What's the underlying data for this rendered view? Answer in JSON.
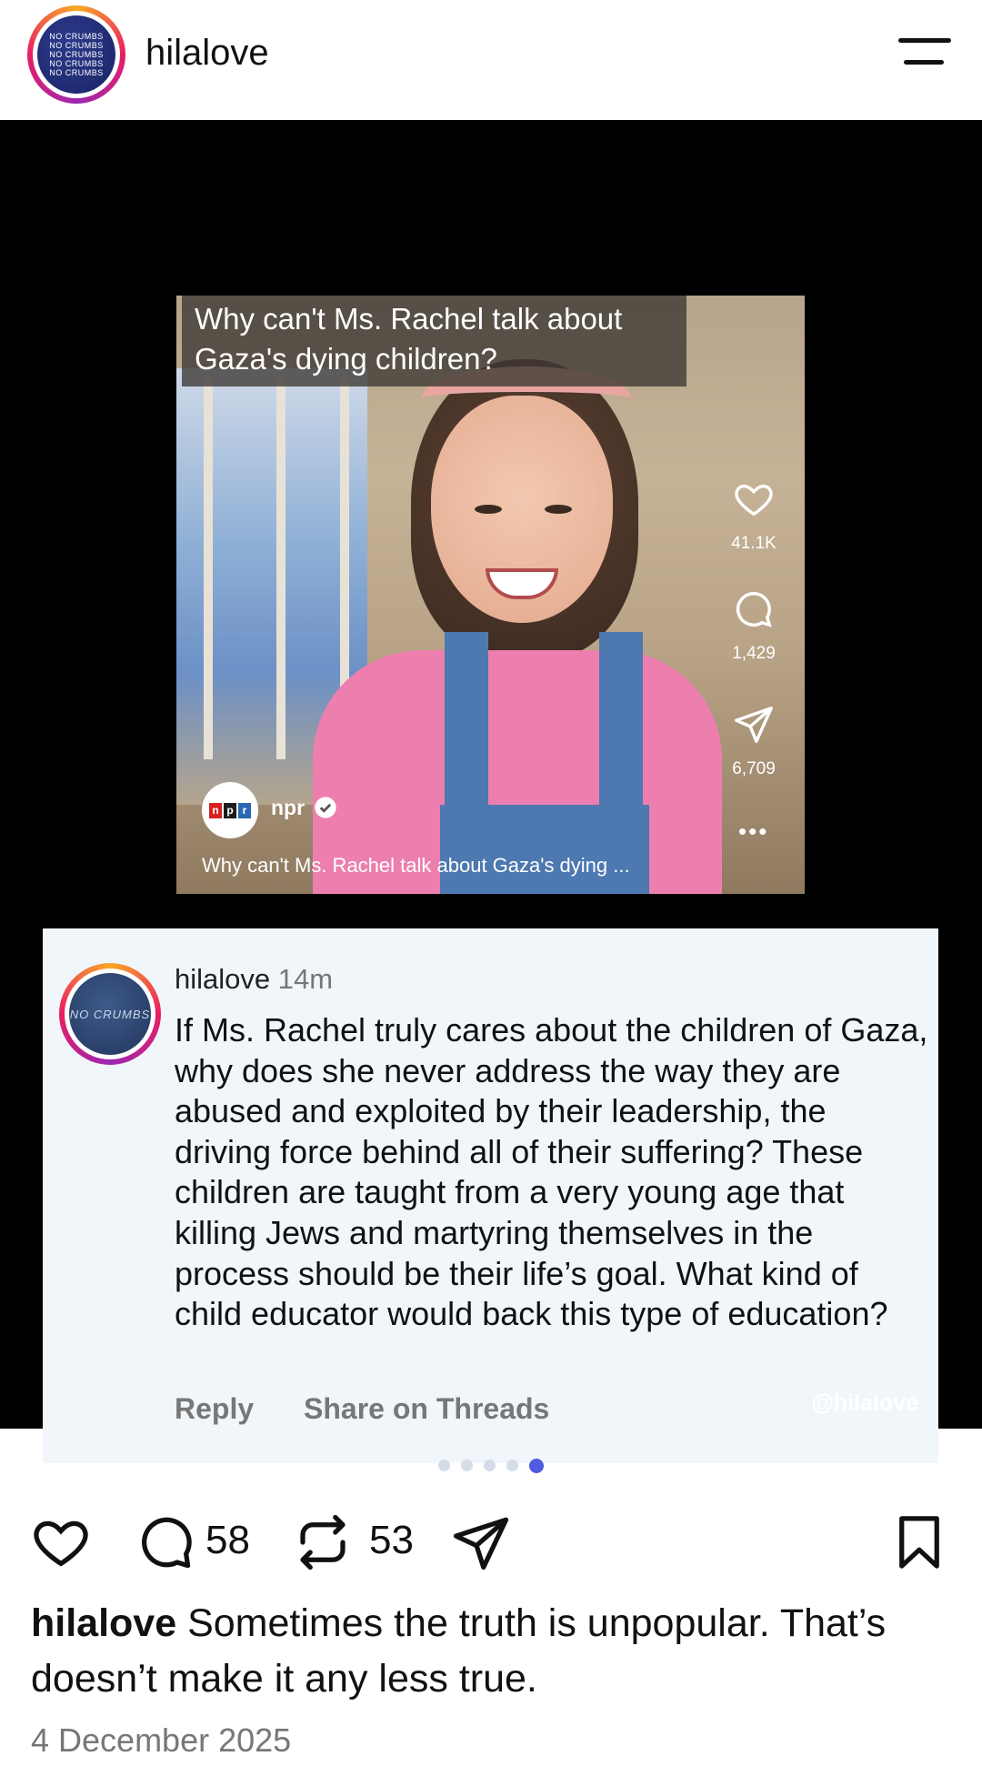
{
  "header": {
    "username": "hilalove",
    "avatar_text": [
      "NO CRUMBS",
      "NO CRUMBS",
      "NO CRUMBS",
      "NO CRUMBS",
      "NO CRUMBS"
    ]
  },
  "video": {
    "title_line1": "Why can't Ms. Rachel talk about",
    "title_line2": "Gaza's dying children?",
    "likes": "41.1K",
    "comments": "1,429",
    "shares": "6,709",
    "account": "npr",
    "npr_letters": [
      "n",
      "p",
      "r"
    ],
    "caption": "Why can't Ms. Rachel talk about Gaza's dying ..."
  },
  "comment": {
    "avatar_text": "NO CRUMBS",
    "username": "hilalove",
    "time": "14m",
    "text": "If Ms. Rachel truly cares about the children of Gaza, why does she never address the way they are abused and exploited by their leadership, the driving force behind all of their suffering? These children are taught from a very young age that killing Jews and martyring themselves in the process should be their life’s goal. What kind of child educator would back this type of education?",
    "reply_label": "Reply",
    "share_label": "Share on Threads"
  },
  "watermark": "@hilalove",
  "pagination": {
    "total": 5,
    "active_index": 4
  },
  "actions": {
    "comment_count": "58",
    "repost_count": "53"
  },
  "caption": {
    "username": "hilalove",
    "text": "Sometimes the truth is unpopular. That’s doesn’t make it any less true."
  },
  "date": "4 December 2025",
  "colors": {
    "accent": "#4f5be0",
    "comment_bg": "#f1f6fb",
    "post_bg": "#000000",
    "npr_red": "#d62021",
    "npr_blue": "#2a67b1"
  }
}
